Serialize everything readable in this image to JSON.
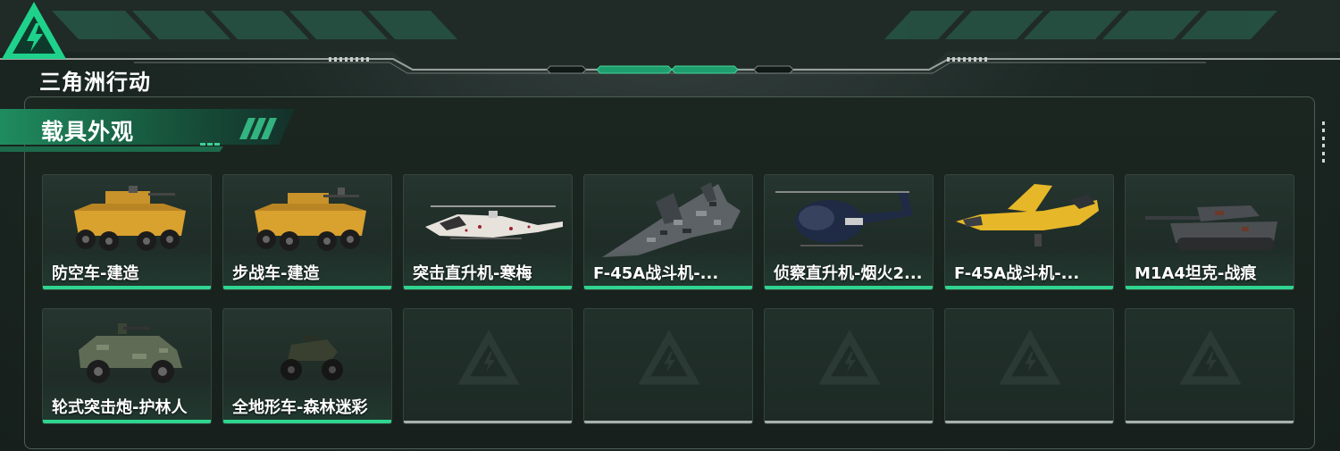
{
  "app": {
    "logo_text": "三角洲行动"
  },
  "section": {
    "title": "载具外观"
  },
  "colors": {
    "accent": "#2fd58f",
    "panel_border": "#4c5d56",
    "empty_underline": "#a9b0ad"
  },
  "vehicles": [
    {
      "label": "防空车-建造",
      "icon": "armored-vehicle-yellow-icon"
    },
    {
      "label": "步战车-建造",
      "icon": "armored-vehicle-yellow-icon"
    },
    {
      "label": "突击直升机-寒梅",
      "icon": "attack-helicopter-icon"
    },
    {
      "label": "F-45A战斗机-...",
      "icon": "fighter-jet-camo-icon"
    },
    {
      "label": "侦察直升机-烟火2...",
      "icon": "scout-helicopter-icon"
    },
    {
      "label": "F-45A战斗机-...",
      "icon": "fighter-jet-yellow-icon"
    },
    {
      "label": "M1A4坦克-战痕",
      "icon": "tank-icon"
    },
    {
      "label": "轮式突击炮-护林人",
      "icon": "wheeled-assault-gun-icon"
    },
    {
      "label": "全地形车-森林迷彩",
      "icon": "atv-icon"
    }
  ],
  "empty_slots": 5
}
